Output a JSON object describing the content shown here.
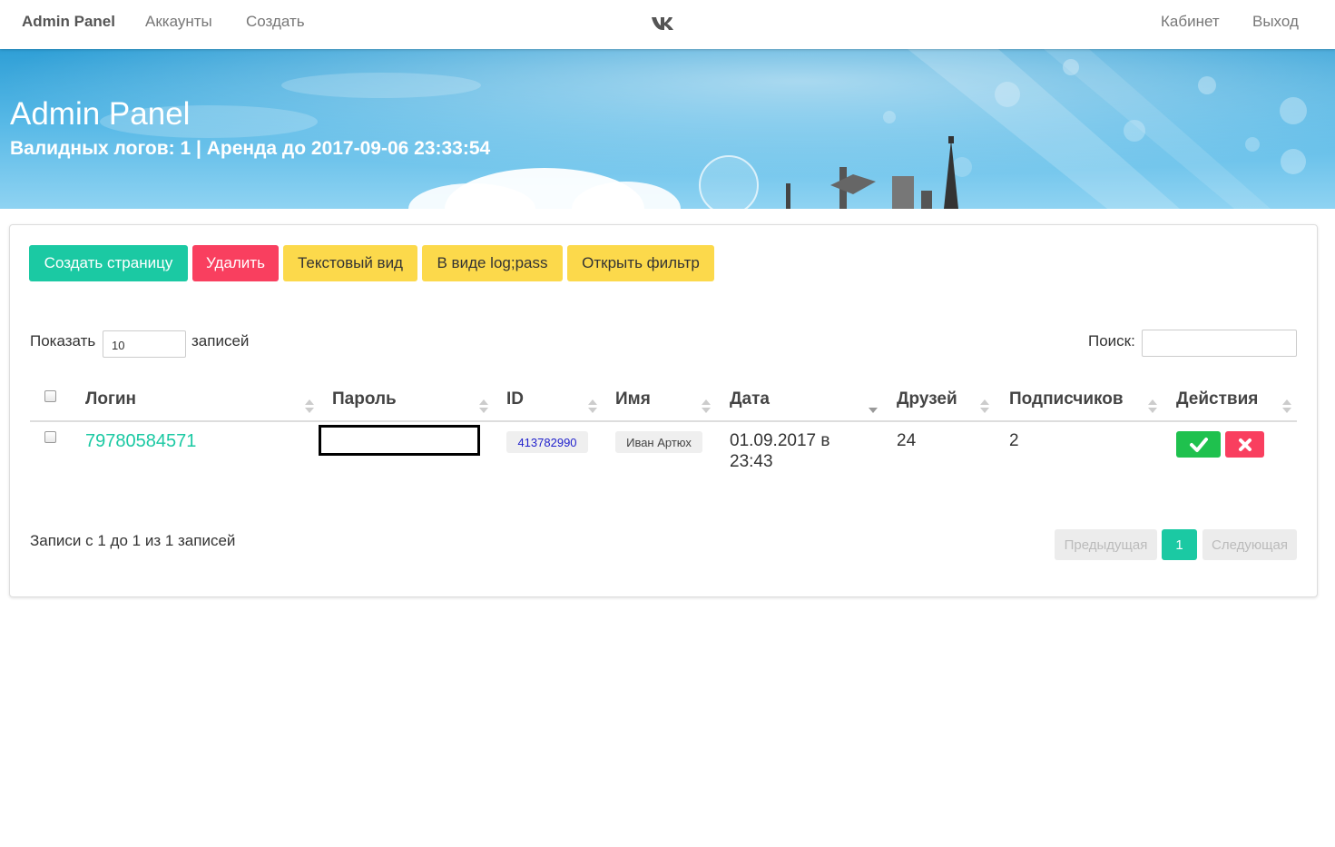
{
  "navbar": {
    "brand": "Admin Panel",
    "links": [
      "Аккаунты",
      "Создать"
    ],
    "right_links": [
      "Кабинет",
      "Выход"
    ],
    "logo_icon": "vk-logo-icon"
  },
  "hero": {
    "title": "Admin Panel",
    "subtitle": "Валидных логов: 1 | Аренда до 2017-09-06 23:33:54"
  },
  "toolbar": {
    "create_page": "Создать страницу",
    "delete": "Удалить",
    "text_view": "Текстовый вид",
    "logpass_view": "В виде log;pass",
    "open_filter": "Открыть фильтр"
  },
  "table_controls": {
    "show_label": "Показать",
    "show_value": "10",
    "records_label": "записей",
    "search_label": "Поиск:",
    "search_value": ""
  },
  "table": {
    "columns": [
      "Логин",
      "Пароль",
      "ID",
      "Имя",
      "Дата",
      "Друзей",
      "Подписчиков",
      "Действия"
    ],
    "rows": [
      {
        "login": "79780584571",
        "password": "",
        "id": "413782990",
        "name": "Иван Артюх",
        "date": "01.09.2017 в 23:43",
        "friends": "24",
        "followers": "2"
      }
    ]
  },
  "footer": {
    "info": "Записи с 1 до 1 из 1 записей",
    "prev": "Предыдущая",
    "current_page": "1",
    "next": "Следующая"
  },
  "colors": {
    "accent": "#1bc9a3",
    "danger": "#f93f5f",
    "warning": "#fcd94b",
    "success": "#1fc14e"
  }
}
